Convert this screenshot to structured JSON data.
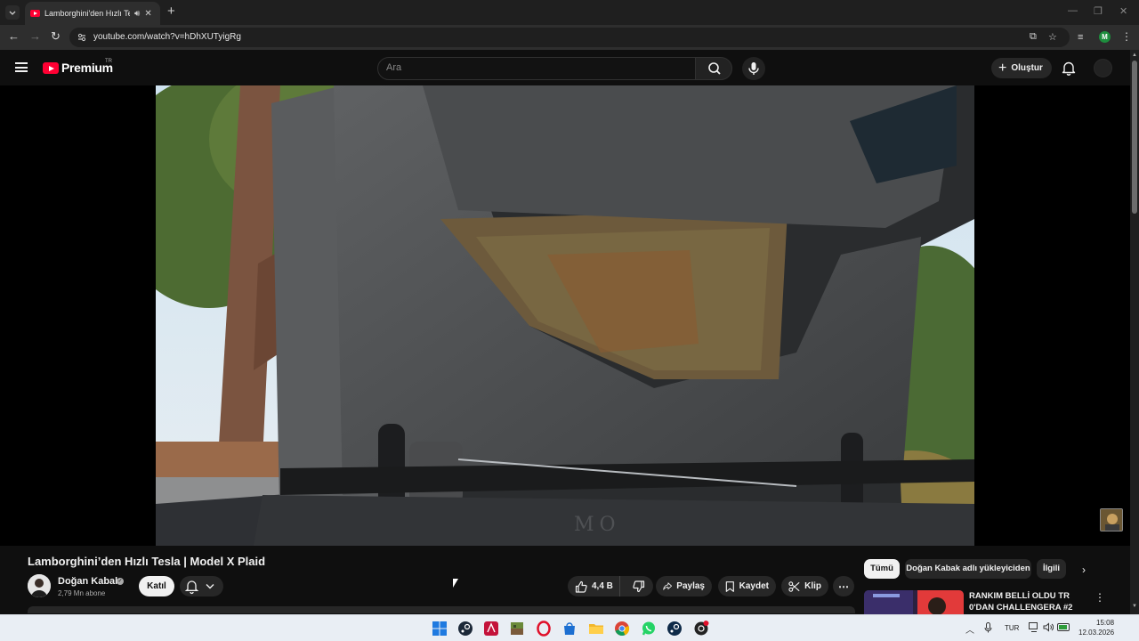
{
  "browser": {
    "tab": {
      "title": "Lamborghini'den Hızlı Tesla",
      "close_label": "✕"
    },
    "new_tab_label": "+",
    "url": "youtube.com/watch?v=hDhXUTyigRg",
    "profile_initial": "M"
  },
  "masthead": {
    "wordmark": "Premium",
    "country_code": "TR",
    "search_placeholder": "Ara",
    "create_label": "Oluştur"
  },
  "video": {
    "title": "Lamborghini’den Hızlı Tesla | Model X Plaid",
    "channel_name": "Doğan Kabak",
    "subscribers": "2,79 Mn abone",
    "join_label": "Katıl",
    "likes": "4,4 B",
    "share_label": "Paylaş",
    "save_label": "Kaydet",
    "clip_label": "Klip"
  },
  "sidebar": {
    "chips": [
      {
        "label": "Tümü",
        "selected": true
      },
      {
        "label": "Doğan Kabak adlı yükleyiciden",
        "selected": false
      },
      {
        "label": "İlgili",
        "selected": false
      }
    ],
    "recommendation": {
      "title": "RANKIM BELLİ OLDU TR 0'DAN CHALLENGERA #2"
    }
  },
  "taskbar": {
    "apps": [
      "windows-start",
      "steam",
      "adobe-acrobat",
      "minecraft",
      "opera-gx",
      "microsoft-store",
      "file-explorer",
      "chrome",
      "whatsapp",
      "steam-2",
      "ea-app"
    ],
    "language": "TUR",
    "time": "15:08",
    "date": "12.03.2026"
  },
  "colors": {
    "youtube_red": "#ff0033",
    "background": "#0f0f0f",
    "chip_bg": "#272727"
  }
}
